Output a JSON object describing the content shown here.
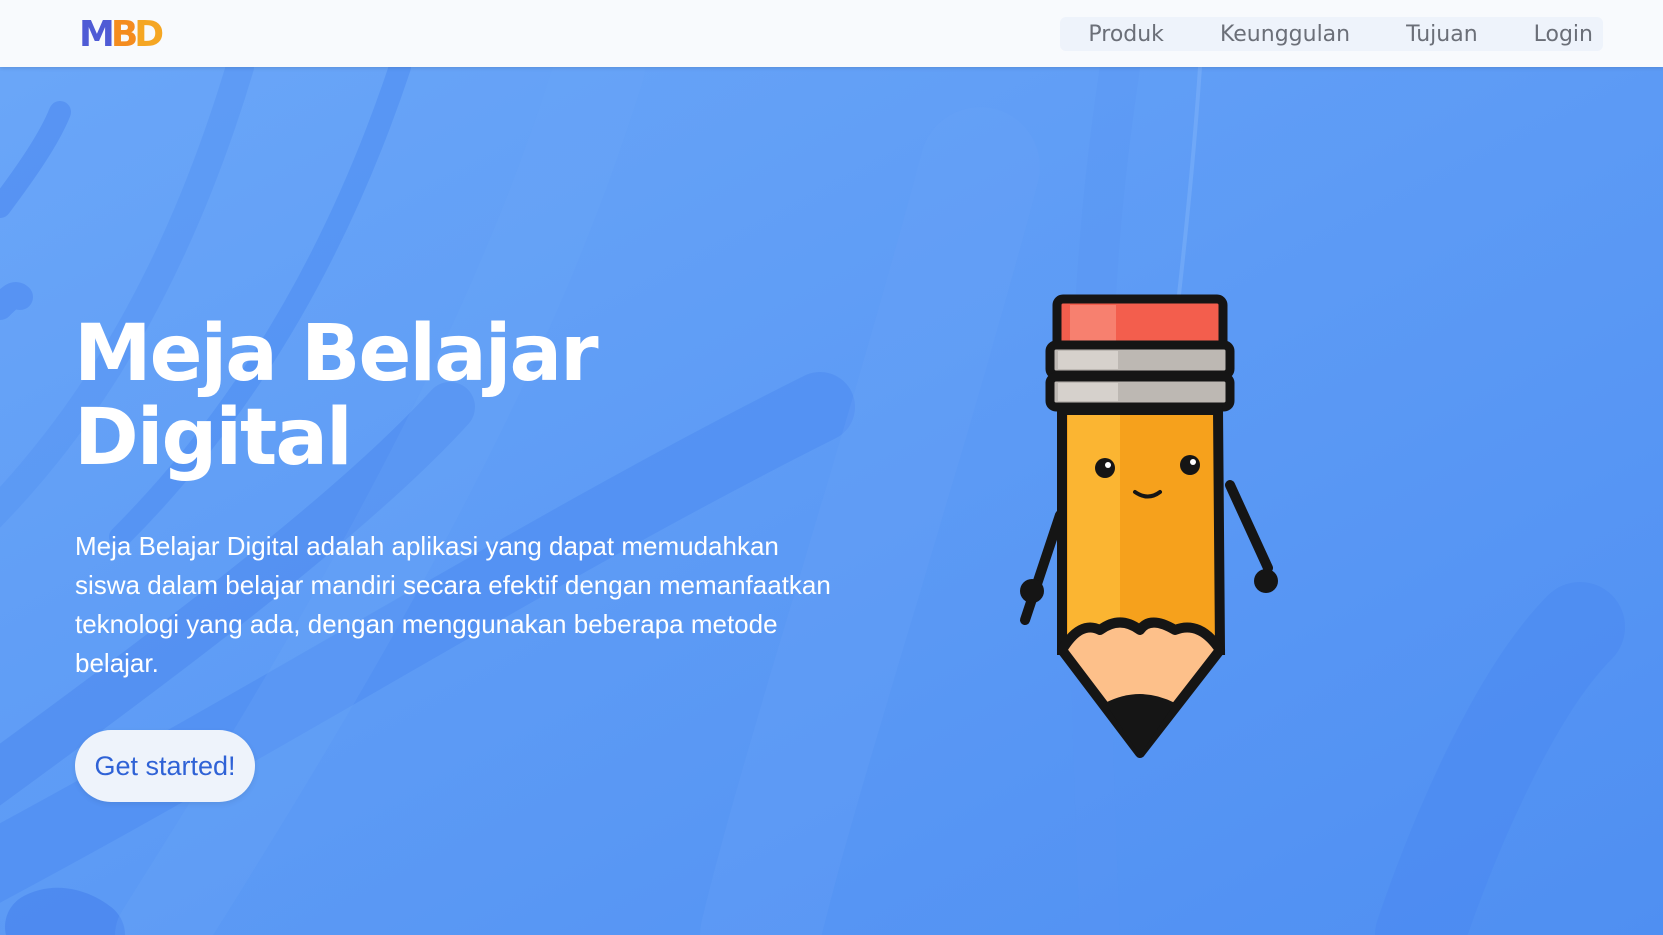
{
  "brand": {
    "logo_part1": "M",
    "logo_part2": "B",
    "logo_part3": "D",
    "colors": {
      "logo_primary": "#4f5bd5",
      "logo_secondary": "#f48c1f",
      "hero_background": "#5b9af5",
      "button_text": "#2f62d6"
    }
  },
  "nav": {
    "items": [
      {
        "label": "Produk"
      },
      {
        "label": "Keunggulan"
      },
      {
        "label": "Tujuan"
      },
      {
        "label": "Login"
      }
    ]
  },
  "hero": {
    "title_line1": "Meja Belajar",
    "title_line2": "Digital",
    "description": "Meja Belajar Digital adalah aplikasi yang dapat memudahkan siswa dalam belajar mandiri secara efektif dengan memanfaatkan teknologi yang ada, dengan menggunakan beberapa metode belajar.",
    "cta_label": "Get started!",
    "illustration": "pencil-mascot-icon"
  }
}
